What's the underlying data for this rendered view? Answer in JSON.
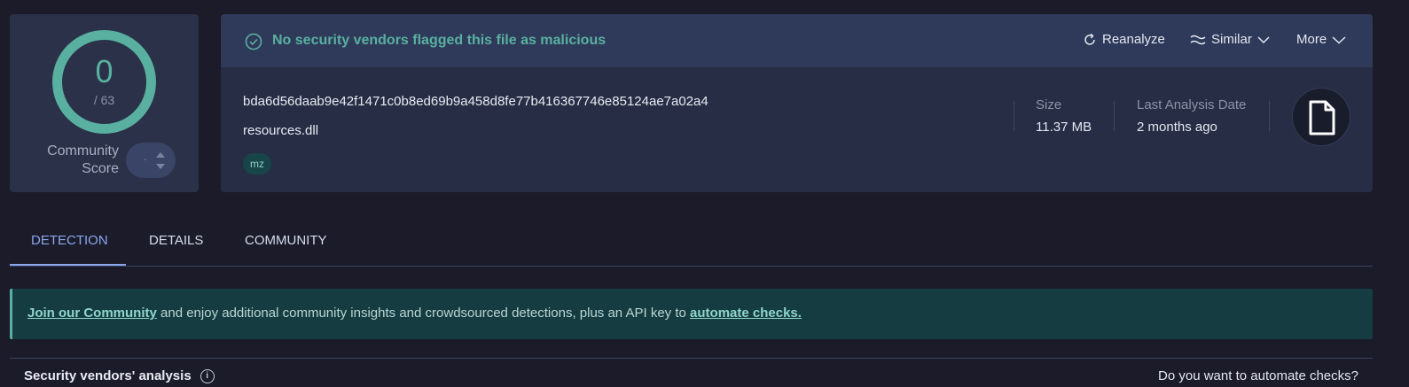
{
  "score": {
    "value": "0",
    "total": "/ 63",
    "ring_color": "#59b0a0",
    "community_label_line1": "Community",
    "community_label_line2": "Score",
    "vote_value": "-"
  },
  "status": {
    "icon": "check-circle-icon",
    "text": "No security vendors flagged this file as malicious",
    "color": "#59b0a0"
  },
  "actions": {
    "reanalyze": "Reanalyze",
    "similar": "Similar",
    "more": "More"
  },
  "file": {
    "hash": "bda6d56daab9e42f1471c0b8ed69b9a458d8fe77b416367746e85124ae7a02a4",
    "name": "resources.dll",
    "tag": "mz",
    "size_label": "Size",
    "size_value": "11.37 MB",
    "date_label": "Last Analysis Date",
    "date_value": "2 months ago",
    "type_icon": "file-icon"
  },
  "tabs": [
    {
      "label": "DETECTION",
      "active": true
    },
    {
      "label": "DETAILS",
      "active": false
    },
    {
      "label": "COMMUNITY",
      "active": false
    }
  ],
  "banner": {
    "link1": "Join our Community",
    "middle": " and enjoy additional community insights and crowdsourced detections, plus an API key to ",
    "link2": "automate checks."
  },
  "section": {
    "title": "Security vendors' analysis",
    "automate_question": "Do you want to automate checks?"
  }
}
